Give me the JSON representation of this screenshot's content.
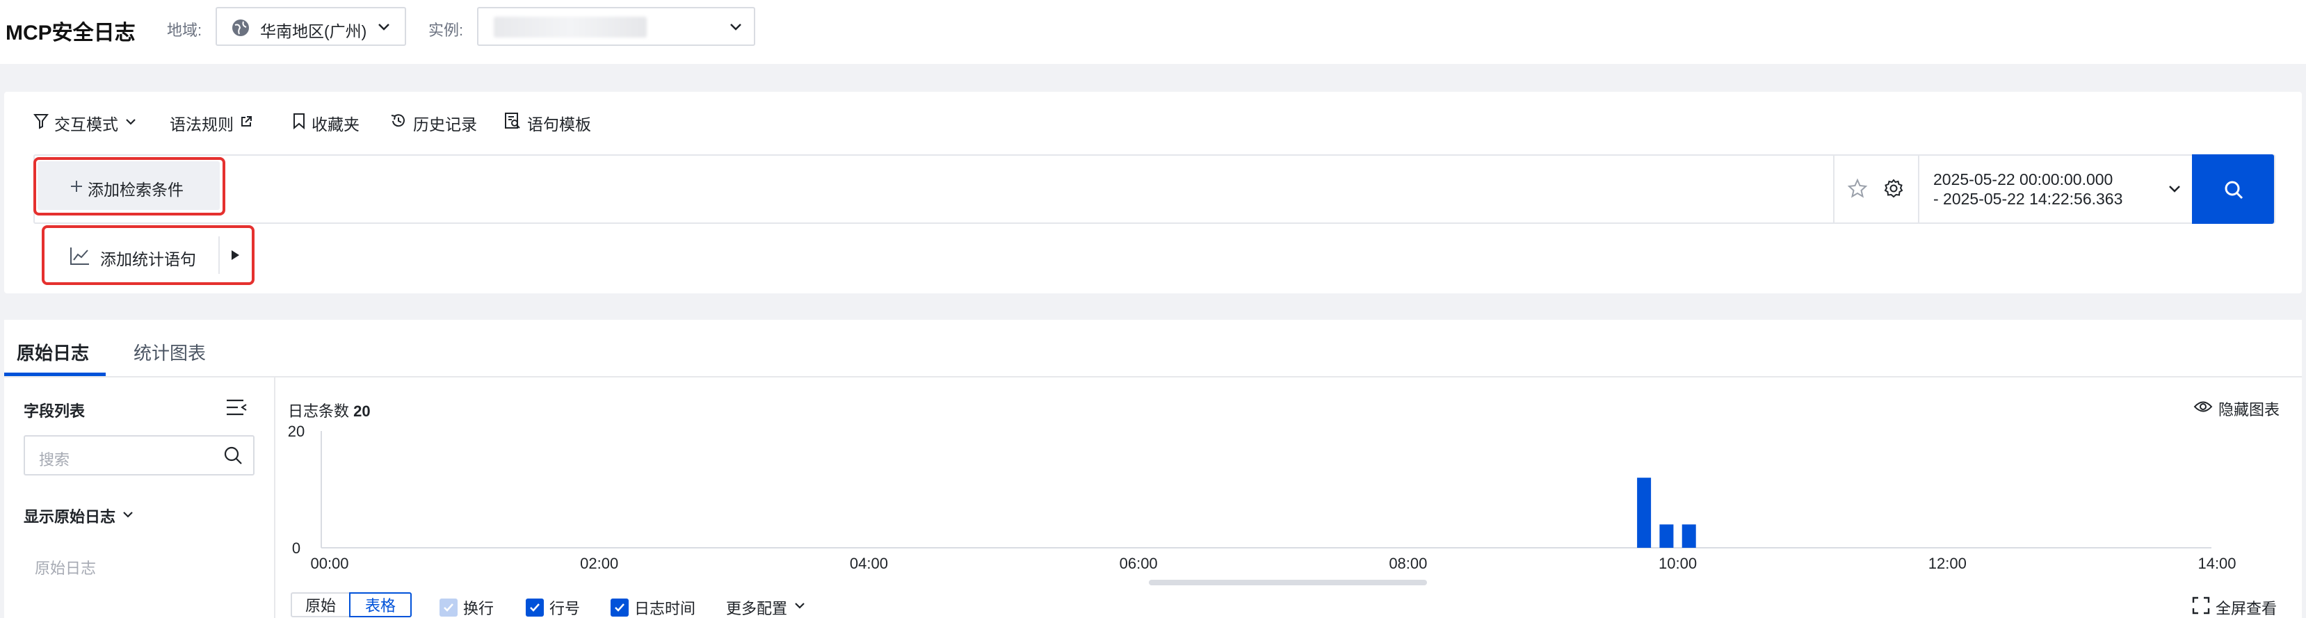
{
  "header": {
    "title": "MCP安全日志",
    "region_label": "地域:",
    "region_value": "华南地区(广州)",
    "instance_label": "实例:"
  },
  "toolbar": {
    "interaction_mode": "交互模式",
    "syntax_rules": "语法规则",
    "favorites": "收藏夹",
    "history": "历史记录",
    "templates": "语句模板"
  },
  "query": {
    "add_condition": "添加检索条件",
    "add_statistics": "添加统计语句",
    "time_start": "2025-05-22 00:00:00.000",
    "time_end": "- 2025-05-22 14:22:56.363"
  },
  "tabs": {
    "raw_log": "原始日志",
    "stat_chart": "统计图表"
  },
  "sidebar": {
    "field_list": "字段列表",
    "search_placeholder": "搜索",
    "show_raw": "显示原始日志",
    "raw_item": "原始日志"
  },
  "chart": {
    "count_label": "日志条数",
    "count_value": "20",
    "hide_chart": "隐藏图表"
  },
  "chart_data": {
    "type": "bar",
    "title": "",
    "xlabel": "",
    "ylabel": "",
    "x_ticks": [
      "00:00",
      "02:00",
      "04:00",
      "06:00",
      "08:00",
      "10:00",
      "12:00",
      "14:00"
    ],
    "y_ticks": [
      "0",
      "20"
    ],
    "ylim": [
      0,
      20
    ],
    "xlim_hours": [
      0,
      14.38
    ],
    "bars": [
      {
        "x": "09:45",
        "value": 12
      },
      {
        "x": "09:55",
        "value": 4
      },
      {
        "x": "10:05",
        "value": 4
      }
    ],
    "color": "#0052d9"
  },
  "bottom": {
    "raw": "原始",
    "table": "表格",
    "wrap": "换行",
    "line_no": "行号",
    "log_time": "日志时间",
    "more_config": "更多配置",
    "fullscreen": "全屏查看"
  },
  "colors": {
    "primary": "#0052d9",
    "highlight": "#e5312f"
  }
}
